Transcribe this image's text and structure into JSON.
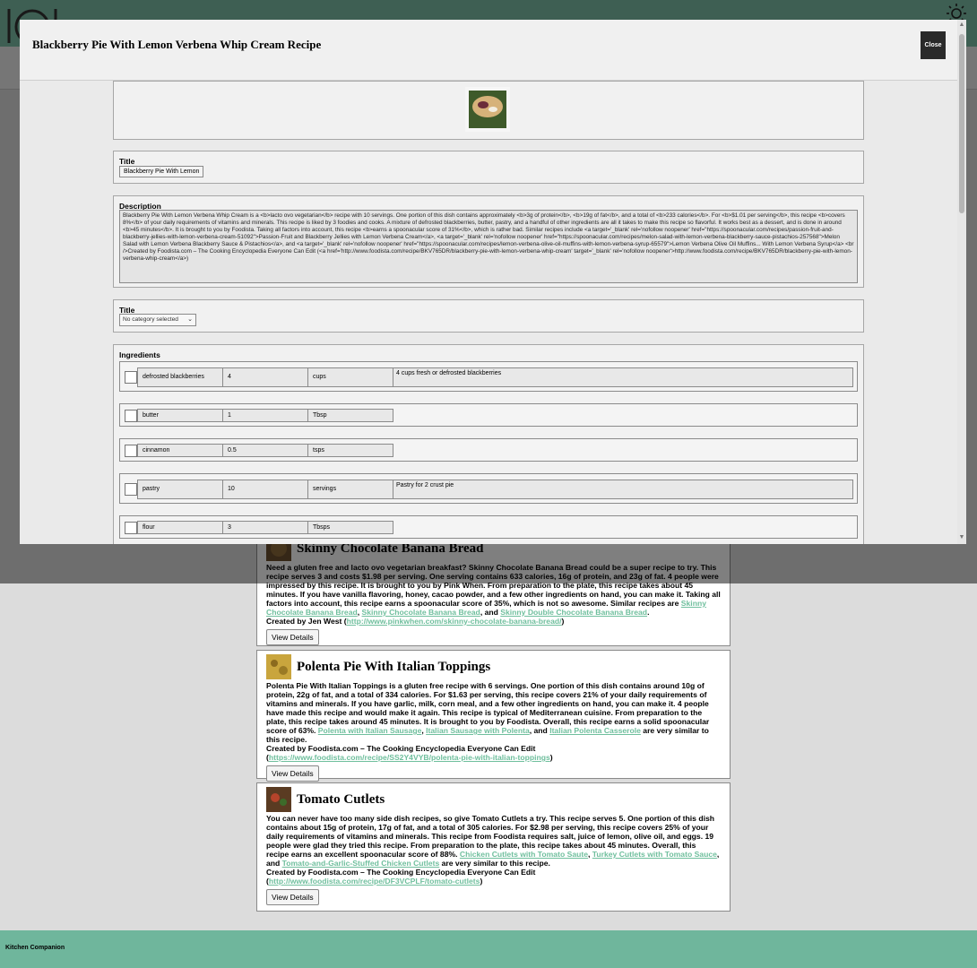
{
  "app": {
    "footer_label": "Kitchen Companion"
  },
  "modal": {
    "title": "Blackberry Pie With Lemon Verbena Whip Cream Recipe",
    "close_label": "Close",
    "title_field": {
      "label": "Title",
      "value": "Blackberry Pie With Lemon"
    },
    "description": {
      "label": "Description",
      "value": "Blackberry Pie With Lemon Verbena Whip Cream is a <b>lacto ovo vegetarian</b> recipe with 10 servings. One portion of this dish contains approximately <b>3g of protein</b>, <b>19g of fat</b>, and a total of <b>233 calories</b>. For <b>$1.01 per serving</b>, this recipe <b>covers 8%</b> of your daily requirements of vitamins and minerals. This recipe is liked by 3 foodies and cooks. A mixture of defrosted blackberries, butter, pastry, and a handful of other ingredients are all it takes to make this recipe so flavorful. It works best as a dessert, and is done in around <b>45 minutes</b>. It is brought to you by Foodista. Taking all factors into account, this recipe <b>earns a spoonacular score of 31%</b>, which is rather bad. Similar recipes include <a target='_blank' rel='nofollow noopener' href=\"https://spoonacular.com/recipes/passion-fruit-and-blackberry-jellies-with-lemon-verbena-cream-51092\">Passion-Fruit and Blackberry Jellies with Lemon Verbena Cream</a>, <a target='_blank' rel='nofollow noopener' href=\"https://spoonacular.com/recipes/melon-salad-with-lemon-verbena-blackberry-sauce-pistachios-257568\">Melon Salad with Lemon Verbena Blackberry Sauce & Pistachios</a>, and <a target='_blank' rel='nofollow noopener' href=\"https://spoonacular.com/recipes/lemon-verbena-olive-oil-muffins-with-lemon-verbena-syrup-65579\">Lemon Verbena Olive Oil Muffins... With Lemon Verbena Syrup</a> <br />Created by Foodista.com – The Cooking Encyclopedia Everyone Can Edit (<a href='http://www.foodista.com/recipe/BKV765DR/blackberry-pie-with-lemon-verbena-whip-cream' target='_blank' rel='nofollow noopener'>http://www.foodista.com/recipe/BKV765DR/blackberry-pie-with-lemon-verbena-whip-cream</a>)"
    },
    "category": {
      "label": "Title",
      "selected": "No category selected"
    },
    "ingredients": {
      "label": "Ingredients",
      "items": [
        {
          "name": "defrosted blackberries",
          "amount": "4",
          "unit": "cups",
          "note": "4 cups fresh or defrosted blackberries"
        },
        {
          "name": "butter",
          "amount": "1",
          "unit": "Tbsp",
          "note": ""
        },
        {
          "name": "cinnamon",
          "amount": "0.5",
          "unit": "tsps",
          "note": ""
        },
        {
          "name": "pastry",
          "amount": "10",
          "unit": "servings",
          "note": "Pastry for 2 crust pie"
        },
        {
          "name": "flour",
          "amount": "3",
          "unit": "Tbsps",
          "note": ""
        }
      ]
    }
  },
  "recipes": [
    {
      "title": "Skinny Chocolate Banana Bread",
      "desc": "Need a gluten free and lacto ovo vegetarian breakfast? Skinny Chocolate Banana Bread could be a super recipe to try. This recipe serves 3 and costs $1.98 per serving. One serving contains 633 calories, 16g of protein, and 23g of fat. 4 people were impressed by this recipe. It is brought to you by Pink When. From preparation to the plate, this recipe takes about 45 minutes. If you have vanilla flavoring, honey, cacao powder, and a few other ingredients on hand, you can make it. Taking all factors into account, this recipe earns a spoonacular score of 35%, which is not so awesome. Similar recipes are",
      "links": [
        "Skinny Chocolate Banana Bread",
        "Skinny Chocolate Banana Bread",
        "Skinny Double Chocolate Banana Bread"
      ],
      "created": "Created by Jen West (",
      "url": "http://www.pinkwhen.com/skinny-chocolate-banana-bread/",
      "button": "View Details"
    },
    {
      "title": "Polenta Pie With Italian Toppings",
      "desc": "Polenta Pie With Italian Toppings is a gluten free recipe with 6 servings. One portion of this dish contains around 10g of protein, 22g of fat, and a total of 334 calories. For $1.63 per serving, this recipe covers 21% of your daily requirements of vitamins and minerals. If you have garlic, milk, corn meal, and a few other ingredients on hand, you can make it. 4 people have made this recipe and would make it again. This recipe is typical of Mediterranean cuisine. From preparation to the plate, this recipe takes around 45 minutes. It is brought to you by Foodista. Overall, this recipe earns a solid spoonacular score of 63%.",
      "links": [
        "Polenta with Italian Sausage",
        "Italian Sausage with Polenta",
        "Italian Polenta Casserole"
      ],
      "tail": " are very similar to this recipe.",
      "created": "Created by Foodista.com – The Cooking Encyclopedia Everyone Can Edit (",
      "url": "https://www.foodista.com/recipe/SS2Y4VYB/polenta-pie-with-italian-toppings",
      "button": "View Details"
    },
    {
      "title": "Tomato Cutlets",
      "desc": "You can never have too many side dish recipes, so give Tomato Cutlets a try. This recipe serves 5. One portion of this dish contains about 15g of protein, 17g of fat, and a total of 305 calories. For $2.98 per serving, this recipe covers 25% of your daily requirements of vitamins and minerals. This recipe from Foodista requires salt, juice of lemon, olive oil, and eggs. 19 people were glad they tried this recipe. From preparation to the plate, this recipe takes about 45 minutes. Overall, this recipe earns an excellent spoonacular score of 88%.",
      "links": [
        "Chicken Cutlets with Tomato Saute",
        "Turkey Cutlets with Tomato Sauce",
        "Tomato-and-Garlic-Stuffed Chicken Cutlets"
      ],
      "tail": " are very similar to this recipe.",
      "created": "Created by Foodista.com – The Cooking Encyclopedia Everyone Can Edit (",
      "url": "http://www.foodista.com/recipe/DF3VCPLF/tomato-cutlets",
      "button": "View Details"
    }
  ],
  "colors": {
    "header_green": "#7cbfa6",
    "footer_green": "#6fb69c",
    "link_green": "#6fbf9d",
    "close_button": "#2a2a2a"
  },
  "icons": [
    "utensils-logo-icon",
    "sun-icon",
    "dropdown-chevron-icon",
    "scroll-up-arrow-icon",
    "scroll-down-arrow-icon"
  ]
}
